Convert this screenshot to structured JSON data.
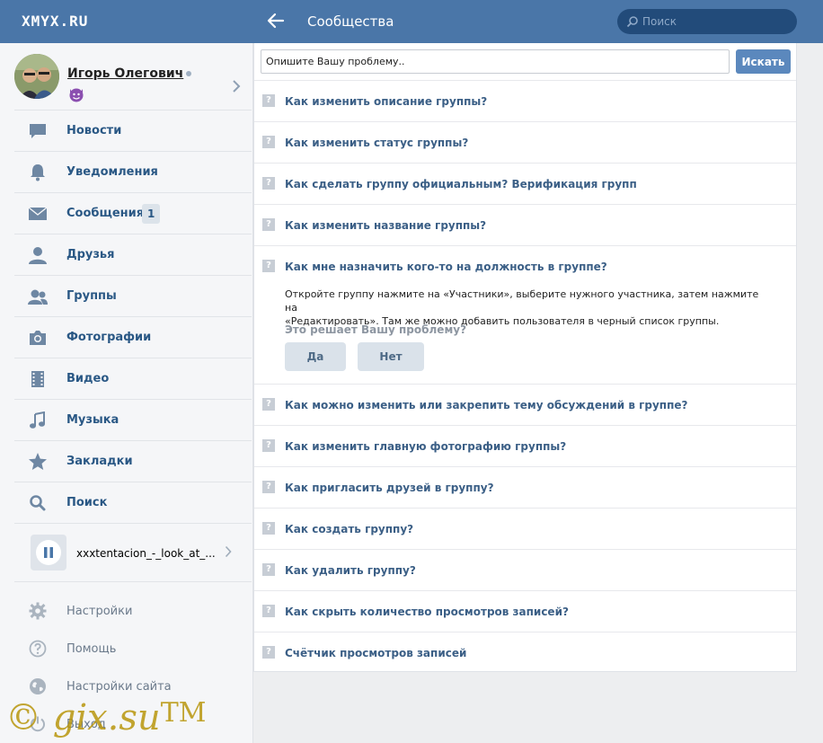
{
  "topbar": {
    "logo": "XMYX.RU",
    "title": "Сообщества",
    "search_placeholder": "Поиск"
  },
  "profile": {
    "name": "Игорь Олегович",
    "status_icon": "devil-emoji"
  },
  "menu": [
    {
      "label": "Новости",
      "icon": "news-icon"
    },
    {
      "label": "Уведомления",
      "icon": "bell-icon"
    },
    {
      "label": "Сообщения",
      "icon": "envelope-icon",
      "badge": "1"
    },
    {
      "label": "Друзья",
      "icon": "person-icon"
    },
    {
      "label": "Группы",
      "icon": "group-icon"
    },
    {
      "label": "Фотографии",
      "icon": "camera-icon"
    },
    {
      "label": "Видео",
      "icon": "film-icon"
    },
    {
      "label": "Музыка",
      "icon": "music-note-icon"
    },
    {
      "label": "Закладки",
      "icon": "star-icon"
    },
    {
      "label": "Поиск",
      "icon": "search-icon"
    }
  ],
  "player": {
    "track": "xxxtentacion_-_look_at_..."
  },
  "bottom_menu": [
    {
      "label": "Настройки",
      "icon": "gear-icon"
    },
    {
      "label": "Помощь",
      "icon": "help-icon"
    },
    {
      "label": "Настройки сайта",
      "icon": "globe-icon"
    },
    {
      "label": "Выход",
      "icon": "power-icon"
    }
  ],
  "watermark": {
    "text": "gix.su",
    "tm": "TM"
  },
  "help": {
    "input_placeholder": "Опишите Вашу проблему..",
    "search_button": "Искать",
    "questions": [
      "Как изменить описание группы?",
      "Как изменить статус группы?",
      "Как сделать группу официальным? Верификация групп",
      "Как изменить название группы?",
      "Как мне назначить кого-то на должность в группе?",
      "Как можно изменить или закрепить тему обсуждений в группе?",
      "Как изменить главную фотографию группы?",
      "Как пригласить друзей в группу?",
      "Как создать группу?",
      "Как удалить группу?",
      "Как скрыть количество просмотров записей?",
      "Счётчик просмотров записей"
    ],
    "open_answer": {
      "line1": "Откройте группу нажмите на «Участники», выберите нужного участника, затем нажмите на",
      "line2": "«Редактировать». Там же можно добавить пользователя в черный список группы.",
      "helpful": "Это решает Вашу проблему?",
      "yes": "Да",
      "no": "Нет"
    },
    "q_mark": "?"
  },
  "colors": {
    "header": "#4a76a8",
    "link": "#2a5885",
    "question": "#3b5f86",
    "button": "#5b88bd"
  }
}
